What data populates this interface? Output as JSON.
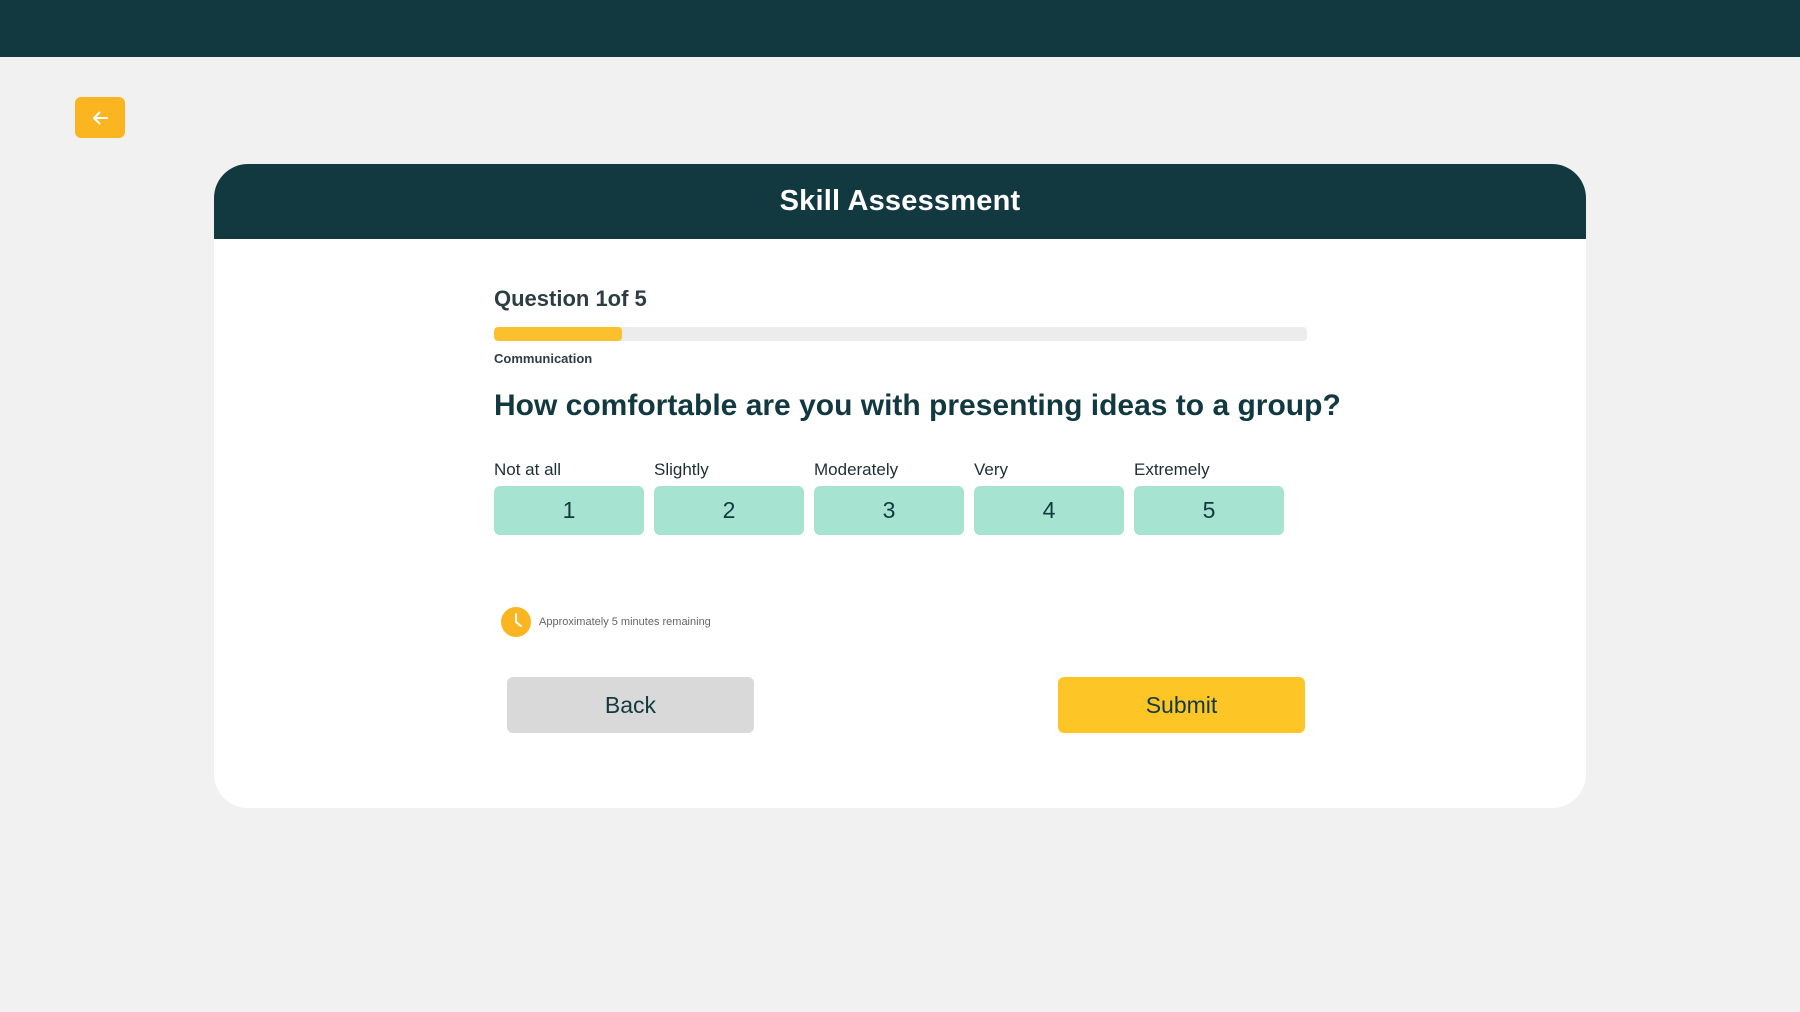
{
  "header": {
    "title": "Skill Assessment"
  },
  "progress": {
    "counter": "Question 1of 5",
    "fraction": 0.157,
    "category": "Communication"
  },
  "question": {
    "text": "How comfortable are you with presenting ideas to a group?"
  },
  "scale": {
    "options": [
      {
        "label": "Not at all",
        "value": "1"
      },
      {
        "label": "Slightly",
        "value": "2"
      },
      {
        "label": "Moderately",
        "value": "3"
      },
      {
        "label": "Very",
        "value": "4"
      },
      {
        "label": "Extremely",
        "value": "5"
      }
    ]
  },
  "timer": {
    "text": "Approximately 5 minutes remaining",
    "icon": "clock-icon"
  },
  "actions": {
    "back_label": "Back",
    "submit_label": "Submit"
  },
  "nav": {
    "back_icon": "arrow-left-icon"
  },
  "colors": {
    "brand_dark": "#133940",
    "accent_yellow": "#fbc02d",
    "option_green": "#a6e3d0",
    "neutral_button": "#d9d9d9"
  }
}
